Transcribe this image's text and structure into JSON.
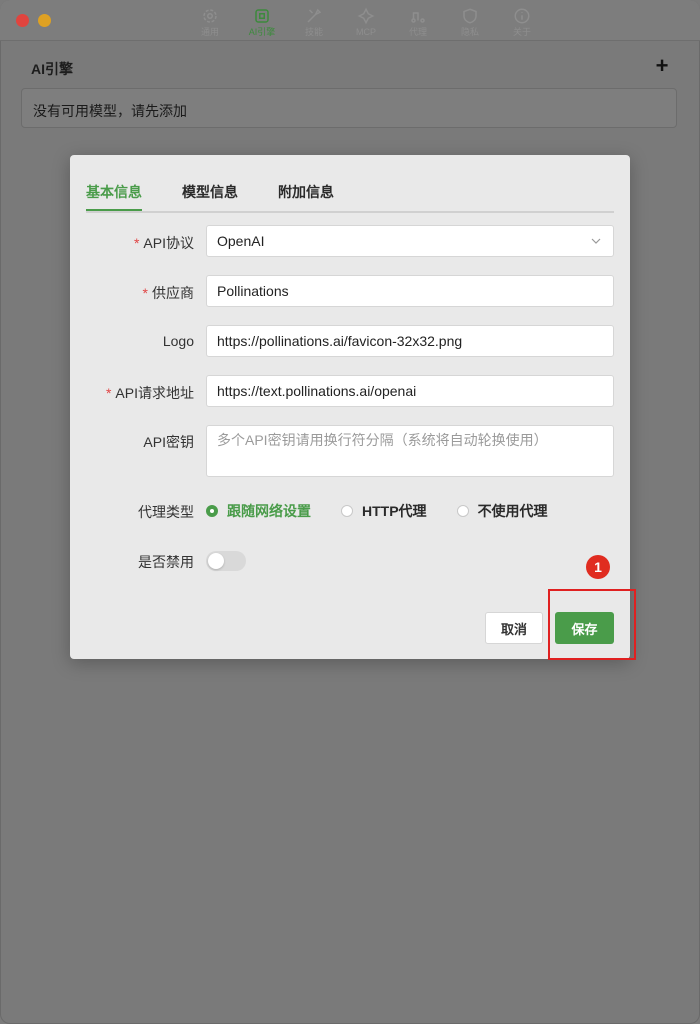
{
  "toolbar": {
    "items": [
      {
        "label": "通用",
        "icon": "gear-icon"
      },
      {
        "label": "AI引擎",
        "icon": "ai-engine-icon"
      },
      {
        "label": "技能",
        "icon": "tools-icon"
      },
      {
        "label": "MCP",
        "icon": "mcp-icon"
      },
      {
        "label": "代理",
        "icon": "proxy-icon"
      },
      {
        "label": "隐私",
        "icon": "shield-icon"
      },
      {
        "label": "关于",
        "icon": "info-icon"
      }
    ],
    "active_index": 1
  },
  "section": {
    "title": "AI引擎",
    "add_label": "+",
    "empty_text": "没有可用模型，请先添加"
  },
  "dialog": {
    "tabs": [
      "基本信息",
      "模型信息",
      "附加信息"
    ],
    "active_tab": "基本信息",
    "fields": {
      "api_protocol": {
        "label": "API协议",
        "required": "*",
        "value": "OpenAI"
      },
      "provider": {
        "label": "供应商",
        "required": "*",
        "value": "Pollinations"
      },
      "logo": {
        "label": "Logo",
        "value": "https://pollinations.ai/favicon-32x32.png"
      },
      "api_url": {
        "label": "API请求地址",
        "required": "*",
        "value": "https://text.pollinations.ai/openai"
      },
      "api_key": {
        "label": "API密钥",
        "value": "",
        "placeholder": "多个API密钥请用换行符分隔（系统将自动轮换使用）"
      },
      "proxy_type": {
        "label": "代理类型",
        "options": [
          "跟随网络设置",
          "HTTP代理",
          "不使用代理"
        ],
        "selected": "跟随网络设置"
      },
      "disabled": {
        "label": "是否禁用",
        "value": false
      }
    },
    "buttons": {
      "cancel": "取消",
      "save": "保存"
    }
  },
  "annotation": {
    "badge": "1"
  },
  "colors": {
    "accent": "#4a9c4a",
    "required": "#e04545",
    "highlight": "#e02020"
  }
}
